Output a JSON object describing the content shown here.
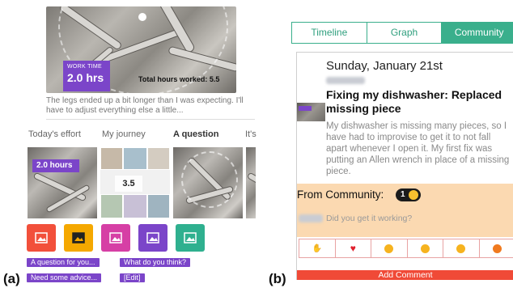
{
  "panel_a": {
    "label": "(a)",
    "hero": {
      "work_time_label": "WORK TIME",
      "work_time_value": "2.0 hrs",
      "total_hours": "Total hours worked: 5.5"
    },
    "story_text": "The legs ended up a bit longer than I was expecting. I'll have to adjust everything else a little...",
    "tabs": [
      "Today's effort",
      "My journey",
      "A question",
      "It's"
    ],
    "active_tab": "A question",
    "thumbnails": [
      {
        "kind": "photo",
        "tag": "2.0 hours"
      },
      {
        "kind": "collage",
        "number": "3.5"
      },
      {
        "kind": "photo"
      },
      {
        "kind": "photo"
      }
    ],
    "color_buttons": [
      {
        "color": "#f2503b",
        "icon": "image-icon"
      },
      {
        "color": "#f5a800",
        "icon": "image-icon"
      },
      {
        "color": "#d63fa5",
        "icon": "image-icon"
      },
      {
        "color": "#7b45c9",
        "icon": "image-icon"
      },
      {
        "color": "#2fb08f",
        "icon": "image-icon"
      }
    ],
    "prompts": [
      "A question for you...",
      "What do you think?",
      "Need some advice...",
      "[Edit]"
    ]
  },
  "panel_b": {
    "label": "(b)",
    "tabs": [
      "Timeline",
      "Graph",
      "Community"
    ],
    "active_tab": "Community",
    "post": {
      "date": "Sunday, January 21st",
      "title": "Fixing my dishwasher: Replaced missing piece",
      "body": "My dishwasher is missing many pieces, so I have had to improvise to get it to not fall apart whenever I open it. My first fix was putting an Allen wrench in place of a missing piece."
    },
    "community": {
      "label": "From Community:",
      "count": "1",
      "comment": "Did you get it working?"
    },
    "reactions": [
      "thumbs-up-icon",
      "heart-icon",
      "surprised-face-icon",
      "laughing-face-icon",
      "sad-face-icon",
      "angry-face-icon"
    ],
    "add_comment": "Add Comment"
  },
  "colors": {
    "accent_purple": "#7b45c9",
    "community_green": "#3aaf8c",
    "community_bg": "#fbd9b1",
    "add_comment_red": "#f04a37"
  }
}
